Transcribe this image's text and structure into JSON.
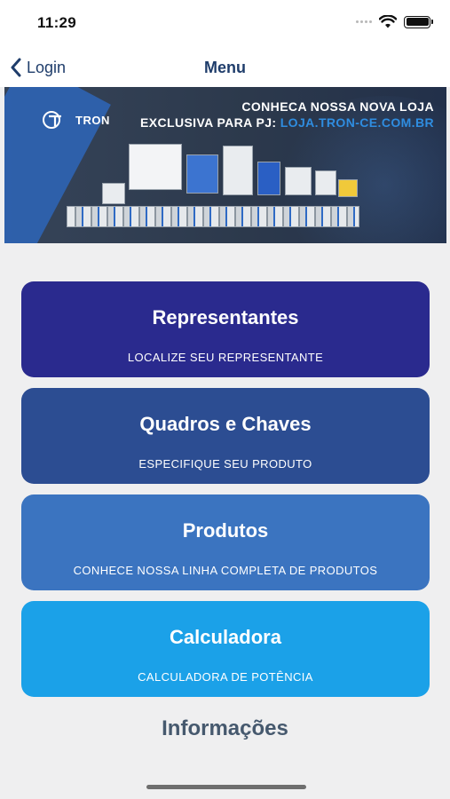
{
  "status_bar": {
    "time": "11:29"
  },
  "nav": {
    "back_label": "Login",
    "title": "Menu"
  },
  "banner": {
    "logo_text": "TRON",
    "line1": "CONHECA NOSSA NOVA LOJA",
    "line2_prefix": "EXCLUSIVA PARA PJ: ",
    "line2_url": "LOJA.TRON-CE.COM.BR"
  },
  "menu": [
    {
      "title": "Representantes",
      "subtitle": "LOCALIZE SEU REPRESENTANTE"
    },
    {
      "title": "Quadros e Chaves",
      "subtitle": "ESPECIFIQUE SEU PRODUTO"
    },
    {
      "title": "Produtos",
      "subtitle": "CONHECE NOSSA LINHA COMPLETA DE PRODUTOS"
    },
    {
      "title": "Calculadora",
      "subtitle": "CALCULADORA DE POTÊNCIA"
    }
  ],
  "info_label": "Informações",
  "colors": {
    "card_1": "#2a2a8e",
    "card_2": "#2c4d92",
    "card_3": "#3b74c0",
    "card_4": "#1ba1e8",
    "nav_text": "#1f3d6b"
  },
  "icons": [
    "signal-icon",
    "wifi-icon",
    "battery-icon",
    "chevron-left-icon",
    "tron-logo-icon"
  ]
}
